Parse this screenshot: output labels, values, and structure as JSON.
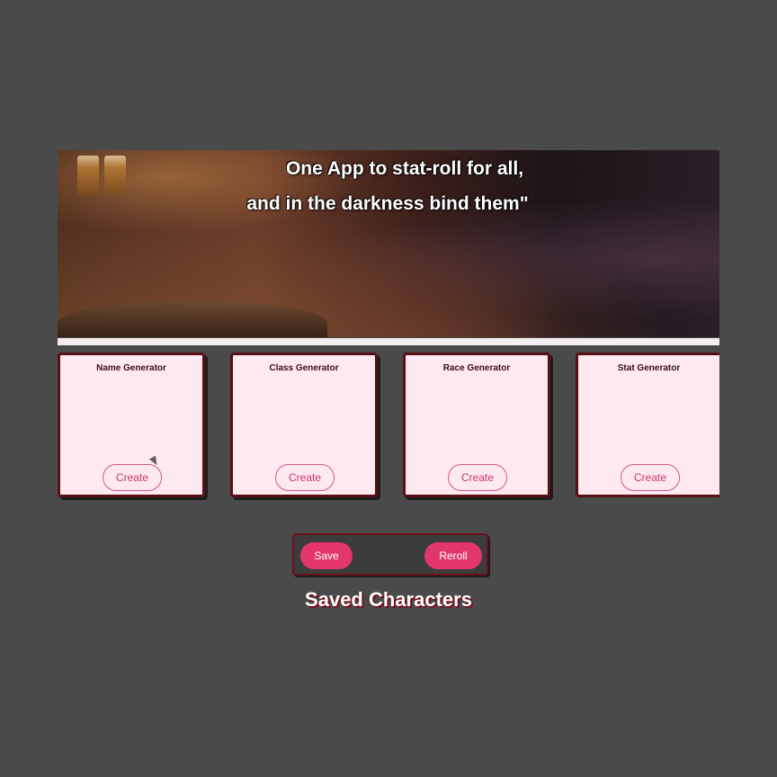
{
  "hero": {
    "line1": "One App to stat-roll for all,",
    "line2": "and in the darkness bind them\""
  },
  "generators": [
    {
      "title": "Name Generator",
      "button": "Create"
    },
    {
      "title": "Class Generator",
      "button": "Create"
    },
    {
      "title": "Race Generator",
      "button": "Create"
    },
    {
      "title": "Stat Generator",
      "button": "Create"
    }
  ],
  "actions": {
    "save_label": "Save",
    "reroll_label": "Reroll"
  },
  "saved": {
    "title": "Saved Characters"
  },
  "colors": {
    "accent": "#e3366d",
    "card_bg": "#fde9ef",
    "card_border": "#5a0f16",
    "page_bg": "#4a4a4a"
  },
  "icons": [
    "mouse-pointer-icon"
  ]
}
